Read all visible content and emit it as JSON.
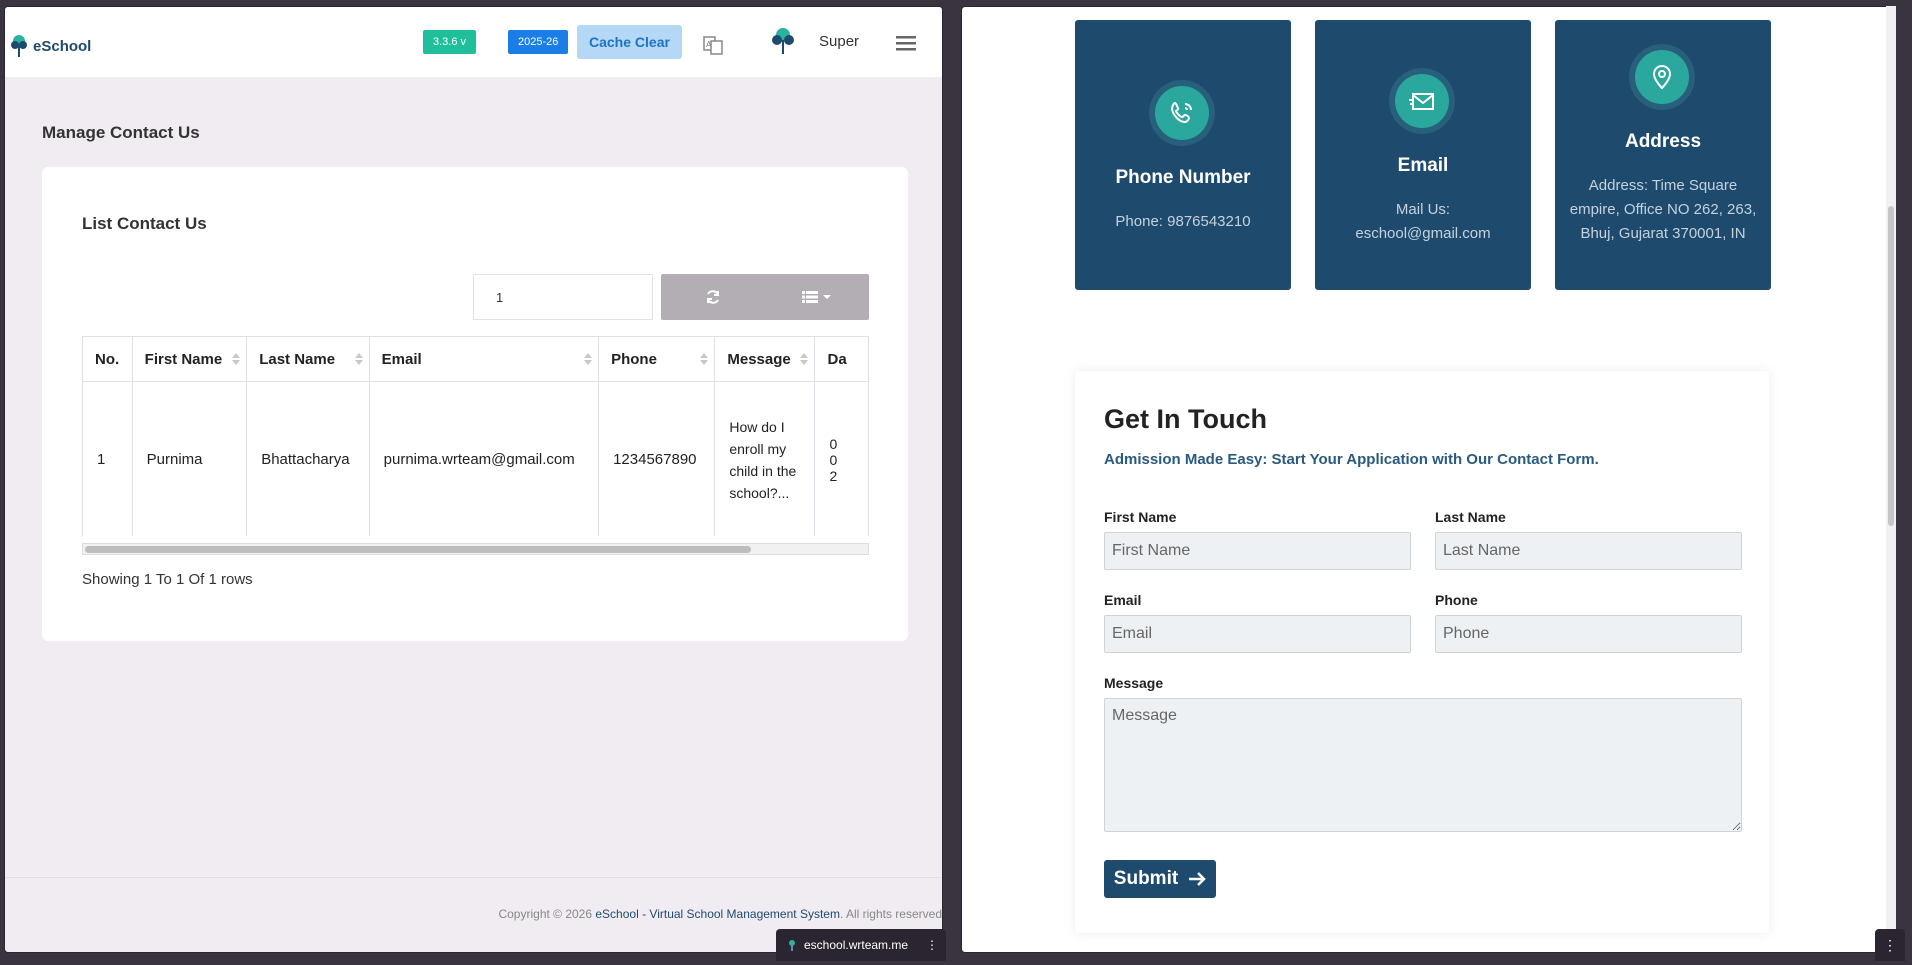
{
  "left": {
    "header": {
      "logo_text": "eSchool",
      "version": "3.3.6 v",
      "session_year": "2025-26",
      "cache_clear": "Cache Clear",
      "user_name": "Super"
    },
    "page_title": "Manage Contact Us",
    "card_title": "List Contact Us",
    "toolbar": {
      "search_value": "1"
    },
    "table": {
      "columns": [
        "No.",
        "First Name",
        "Last Name",
        "Email",
        "Phone",
        "Message",
        "Da"
      ],
      "row": {
        "no": "1",
        "first_name": "Purnima",
        "last_name": "Bhattacharya",
        "email": "purnima.wrteam@gmail.com",
        "phone": "1234567890",
        "message": "How do I enroll my child in the school?...",
        "date": "0\n0\n2"
      }
    },
    "showing": "Showing 1 To 1 Of 1 rows",
    "footer": {
      "prefix": "Copyright © 2026 ",
      "brand": "eSchool - Virtual School Management System",
      "suffix": ". All rights reserved"
    },
    "url": "eschool.wrteam.me"
  },
  "right": {
    "cards": [
      {
        "title": "Phone Number",
        "text": "Phone: 9876543210"
      },
      {
        "title": "Email",
        "text": "Mail Us: eschool@gmail.com"
      },
      {
        "title": "Address",
        "text": "Address: Time Square empire, Office NO 262, 263, Bhuj, Gujarat 370001, IN"
      }
    ],
    "form": {
      "title": "Get In Touch",
      "subtitle": "Admission Made Easy: Start Your Application with Our Contact Form.",
      "first_name_label": "First Name",
      "first_name_placeholder": "First Name",
      "last_name_label": "Last Name",
      "last_name_placeholder": "Last Name",
      "email_label": "Email",
      "email_placeholder": "Email",
      "phone_label": "Phone",
      "phone_placeholder": "Phone",
      "message_label": "Message",
      "message_placeholder": "Message",
      "submit": "Submit"
    }
  },
  "colors": {
    "primary": "#1e4a6e",
    "accent": "#2aa89e",
    "version_badge": "#1fbf9c",
    "year_badge": "#1b7ee6"
  }
}
